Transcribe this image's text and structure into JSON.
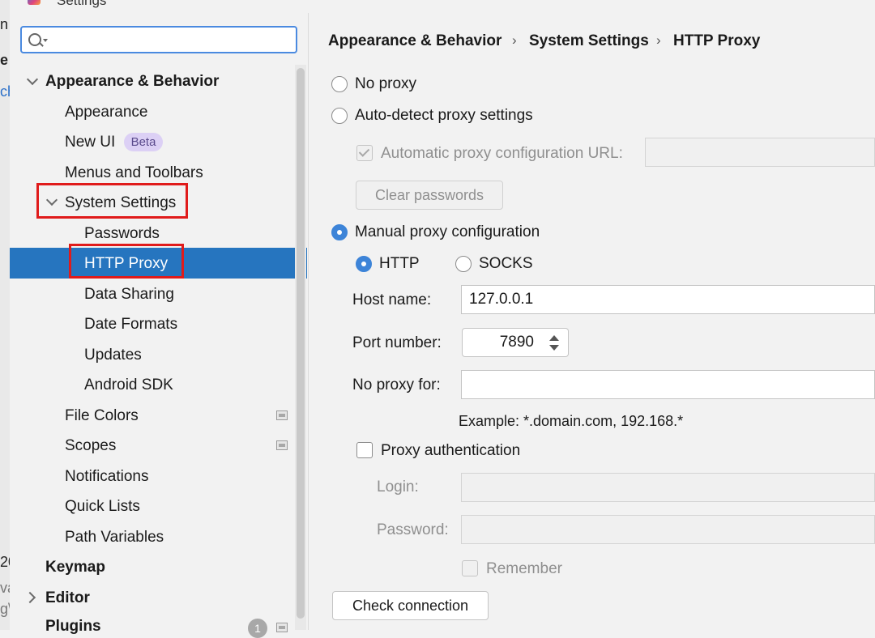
{
  "window": {
    "title": "Settings"
  },
  "edge_fragments": [
    "n",
    "e",
    "ch",
    "20",
    "va",
    "g\\"
  ],
  "search": {
    "value": "",
    "placeholder": ""
  },
  "sidebar": {
    "items": [
      {
        "label": "Appearance & Behavior",
        "bold": true,
        "expanded": true
      },
      {
        "label": "Appearance"
      },
      {
        "label": "New UI",
        "badge": "Beta"
      },
      {
        "label": "Menus and Toolbars"
      },
      {
        "label": "System Settings",
        "expanded": true
      },
      {
        "label": "Passwords"
      },
      {
        "label": "HTTP Proxy",
        "selected": true
      },
      {
        "label": "Data Sharing"
      },
      {
        "label": "Date Formats"
      },
      {
        "label": "Updates"
      },
      {
        "label": "Android SDK"
      },
      {
        "label": "File Colors",
        "project_icon": true
      },
      {
        "label": "Scopes",
        "project_icon": true
      },
      {
        "label": "Notifications"
      },
      {
        "label": "Quick Lists"
      },
      {
        "label": "Path Variables"
      },
      {
        "label": "Keymap",
        "bold": true
      },
      {
        "label": "Editor",
        "bold": true,
        "expanded": false
      },
      {
        "label": "Plugins",
        "bold": true,
        "count": "1"
      }
    ]
  },
  "breadcrumb": [
    "Appearance & Behavior",
    "System Settings",
    "HTTP Proxy"
  ],
  "proxy": {
    "no_proxy": "No proxy",
    "auto_detect": "Auto-detect proxy settings",
    "auto_config_url_label": "Automatic proxy configuration URL:",
    "auto_config_url_value": "",
    "clear_passwords": "Clear passwords",
    "manual": "Manual proxy configuration",
    "selected_mode": "manual",
    "type_http": "HTTP",
    "type_socks": "SOCKS",
    "selected_type": "HTTP",
    "host_label": "Host name:",
    "host_value": "127.0.0.1",
    "port_label": "Port number:",
    "port_value": "7890",
    "no_proxy_for_label": "No proxy for:",
    "no_proxy_for_value": "",
    "example": "Example: *.domain.com, 192.168.*",
    "auth_label": "Proxy authentication",
    "login_label": "Login:",
    "password_label": "Password:",
    "remember_label": "Remember",
    "check_connection": "Check connection"
  },
  "colors": {
    "selection": "#2675bf",
    "accent": "#3d84d8",
    "highlight_box": "#e01b1b",
    "beta_badge": "#dcd0f5"
  }
}
